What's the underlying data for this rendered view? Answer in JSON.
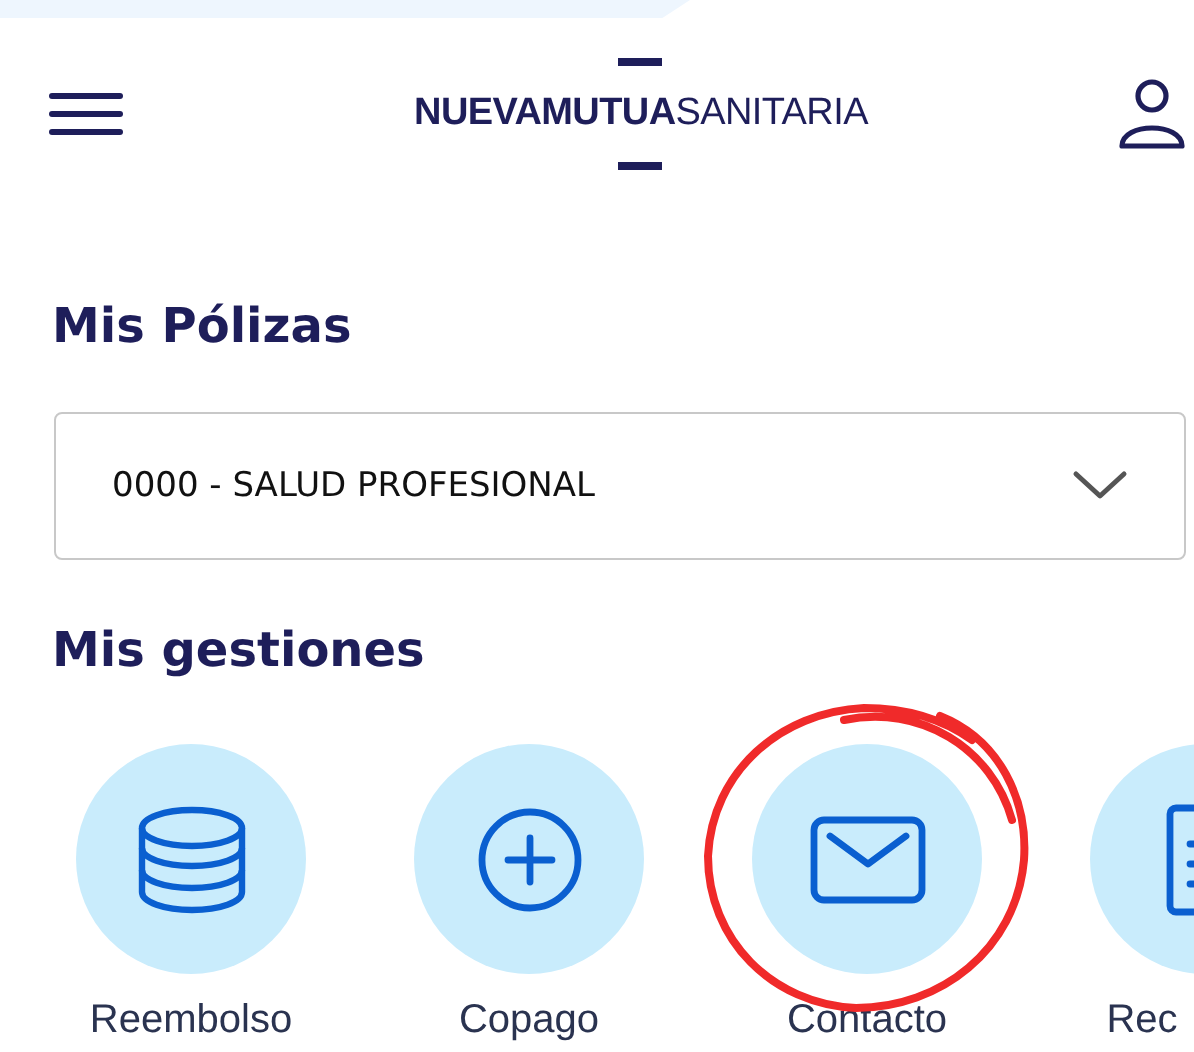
{
  "header": {
    "logo_bold": "NUEVAMUTUA",
    "logo_light": "SANITARIA"
  },
  "policies": {
    "title": "Mis Pólizas",
    "selected_policy": "0000 - SALUD PROFESIONAL"
  },
  "actions": {
    "title": "Mis gestiones",
    "items": [
      {
        "kind": "coins",
        "label": "Reembolso",
        "highlighted": false
      },
      {
        "kind": "plus",
        "label": "Copago",
        "highlighted": false
      },
      {
        "kind": "mail",
        "label": "Contacto",
        "highlighted": true
      },
      {
        "kind": "document",
        "label": "Rec",
        "highlighted": false
      }
    ]
  }
}
